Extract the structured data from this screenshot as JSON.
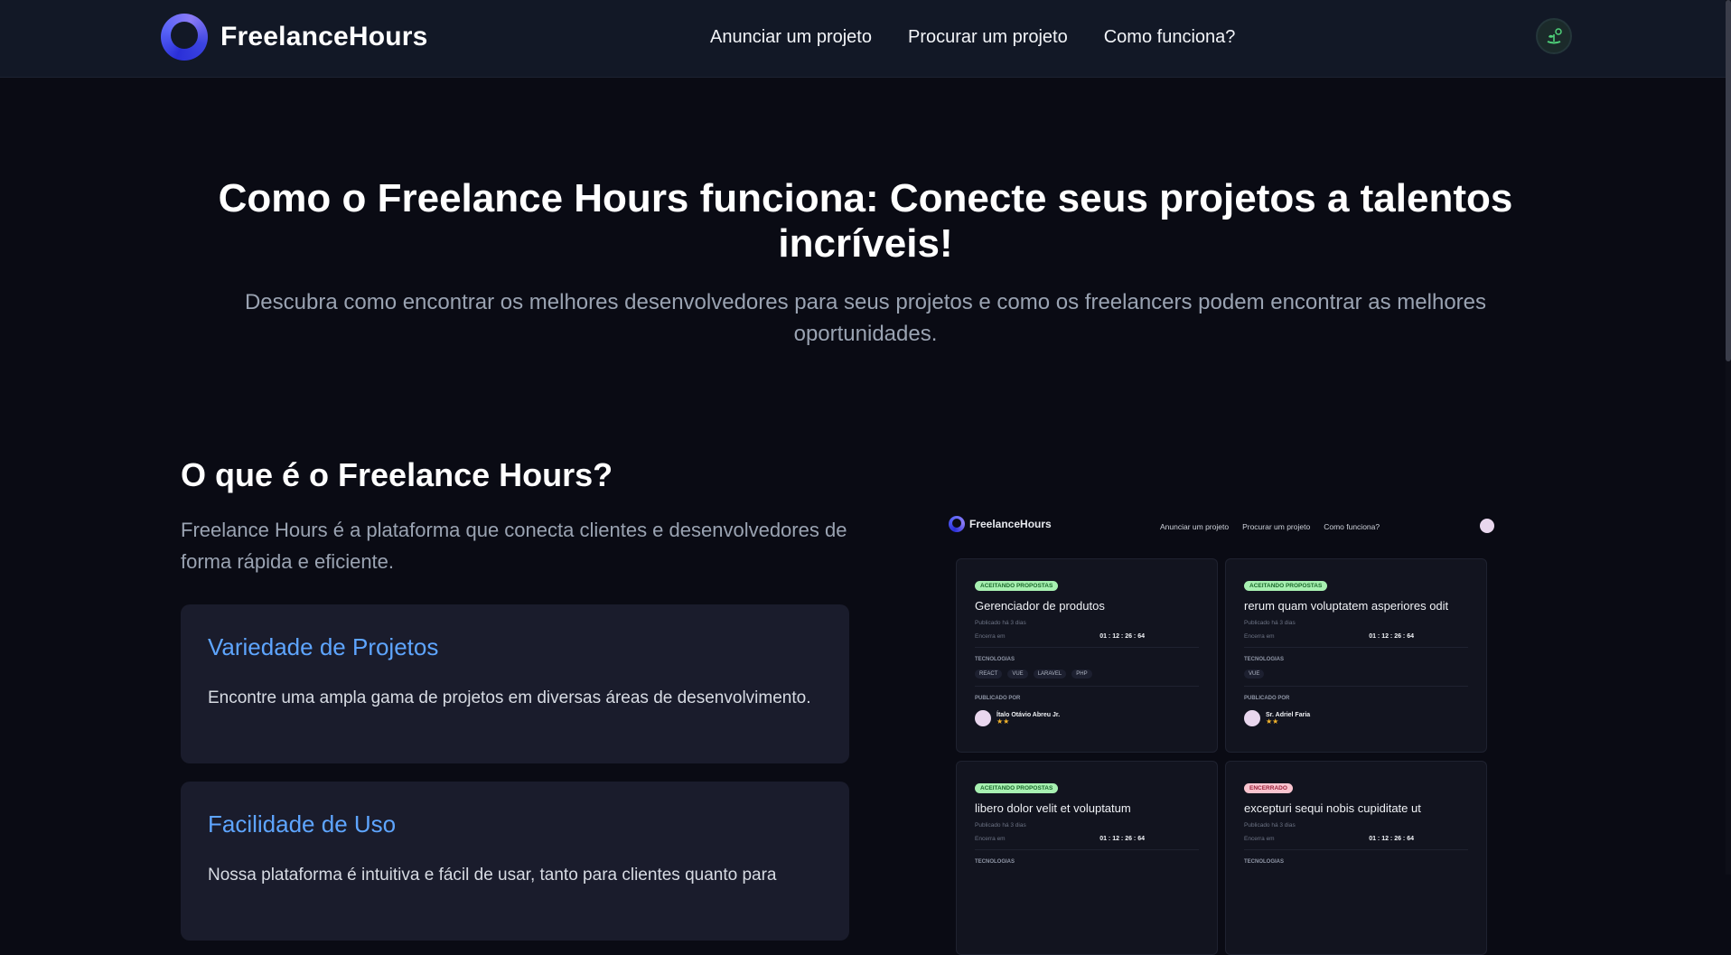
{
  "nav": {
    "brand": "FreelanceHours",
    "links": [
      "Anunciar um projeto",
      "Procurar um projeto",
      "Como funciona?"
    ]
  },
  "hero": {
    "title": "Como o Freelance Hours funciona: Conecte seus projetos a talentos incríveis!",
    "subtitle": "Descubra como encontrar os melhores desenvolvedores para seus projetos e como os freelancers podem encontrar as melhores oportunidades."
  },
  "about": {
    "heading": "O que é o Freelance Hours?",
    "intro": "Freelance Hours é a plataforma que conecta clientes e desenvolvedores de forma rápida e eficiente.",
    "features": [
      {
        "title": "Variedade de Projetos",
        "text": "Encontre uma ampla gama de projetos em diversas áreas de desenvolvimento."
      },
      {
        "title": "Facilidade de Uso",
        "text": "Nossa plataforma é intuitiva e fácil de usar, tanto para clientes quanto para"
      }
    ]
  },
  "preview": {
    "brand": "FreelanceHours",
    "links": [
      "Anunciar um projeto",
      "Procurar um projeto",
      "Como funciona?"
    ],
    "labels": {
      "published": "Publicado há 3 dias",
      "ends": "Encerra em",
      "tech": "TECNOLOGIAS",
      "by": "PUBLICADO POR"
    },
    "projects": [
      {
        "status": "ACEITANDO PROPOSTAS",
        "title": "Gerenciador de produtos",
        "timer": "01 : 12 : 26 : 64",
        "techs": [
          "REACT",
          "VUE",
          "LARAVEL",
          "PHP"
        ],
        "author": "Ítalo Otávio Abreu Jr.",
        "stars": "★★"
      },
      {
        "status": "ACEITANDO PROPOSTAS",
        "title": "rerum quam voluptatem asperiores odit",
        "timer": "01 : 12 : 26 : 64",
        "techs": [
          "VUE"
        ],
        "author": "Sr. Adriel Faria",
        "stars": "★★"
      },
      {
        "status": "ACEITANDO PROPOSTAS",
        "title": "libero dolor velit et voluptatum",
        "timer": "01 : 12 : 26 : 64"
      },
      {
        "status": "ENCERRADO",
        "title": "excepturi sequi nobis cupiditate ut",
        "timer": "01 : 12 : 26 : 64"
      }
    ]
  },
  "colors": {
    "accent": "#5ea5ff",
    "bg": "#0a0b14",
    "card": "#1a1c2c"
  }
}
